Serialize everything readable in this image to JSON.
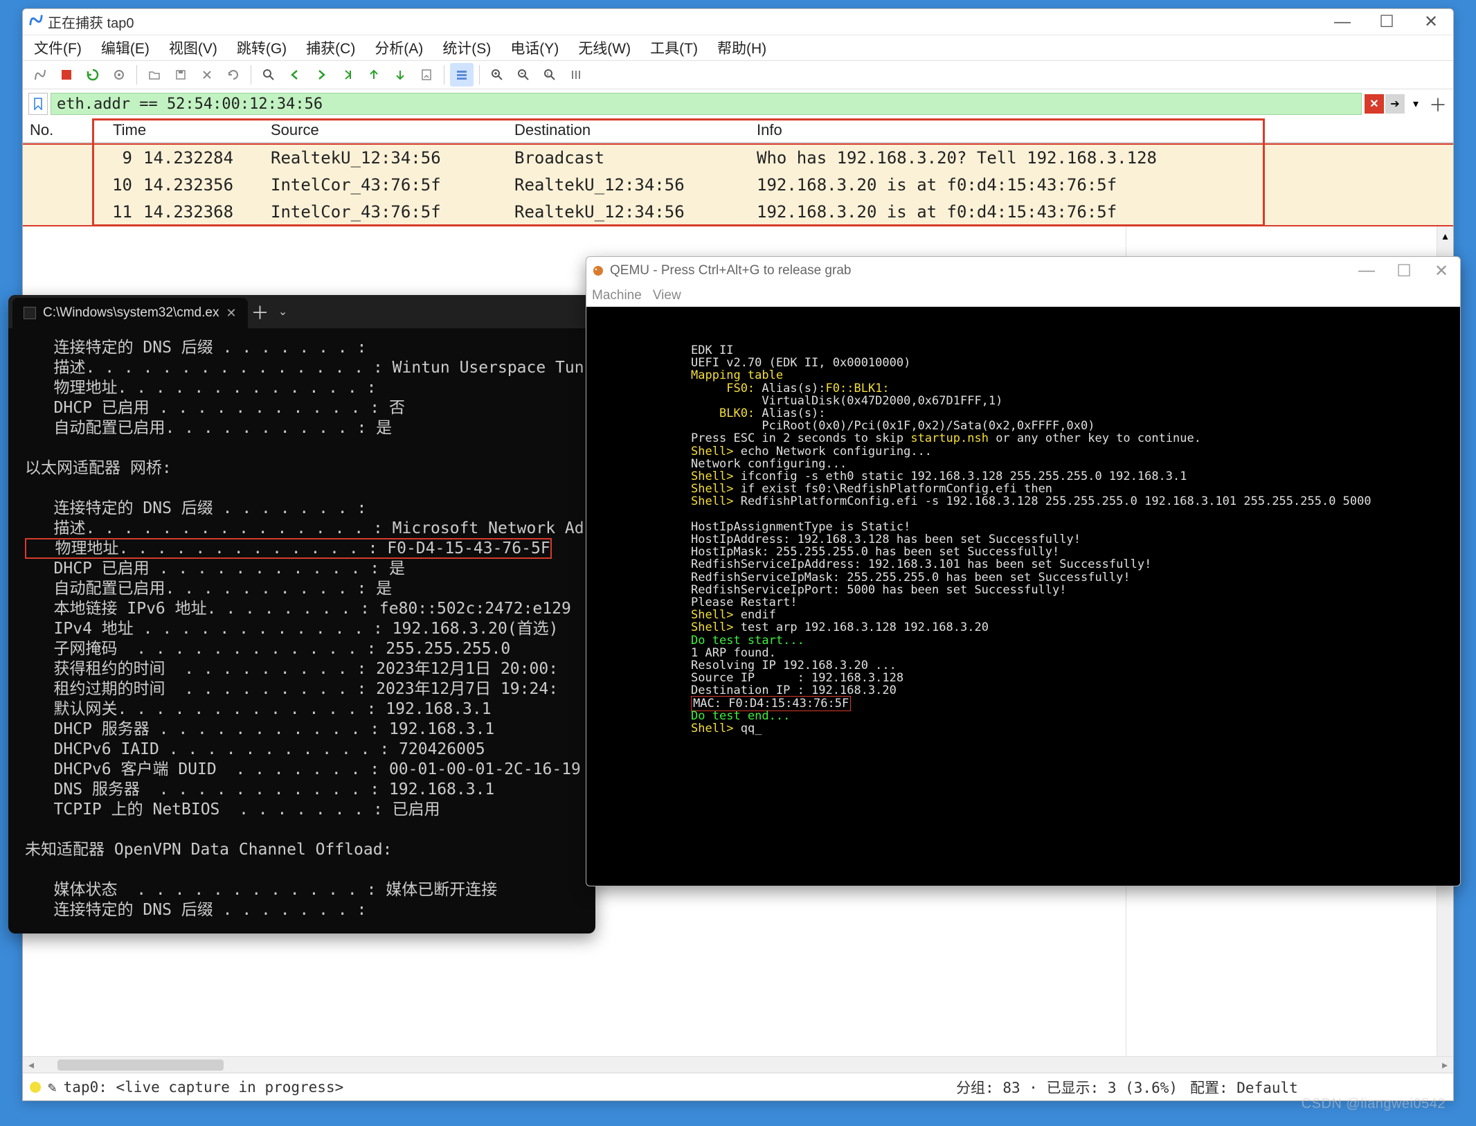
{
  "wireshark": {
    "title": "正在捕获 tap0",
    "window_buttons": {
      "min": "—",
      "max": "☐",
      "close": "✕"
    },
    "menus": [
      "文件(F)",
      "编辑(E)",
      "视图(V)",
      "跳转(G)",
      "捕获(C)",
      "分析(A)",
      "统计(S)",
      "电话(Y)",
      "无线(W)",
      "工具(T)",
      "帮助(H)"
    ],
    "filter_value": "eth.addr == 52:54:00:12:34:56",
    "columns": {
      "no": "No.",
      "time": "Time",
      "src": "Source",
      "dst": "Destination",
      "info": "Info"
    },
    "packets": [
      {
        "no": "9",
        "time": "14.232284",
        "src": "RealtekU_12:34:56",
        "dst": "Broadcast",
        "info": "Who has 192.168.3.20? Tell 192.168.3.128"
      },
      {
        "no": "10",
        "time": "14.232356",
        "src": "IntelCor_43:76:5f",
        "dst": "RealtekU_12:34:56",
        "info": "192.168.3.20 is at f0:d4:15:43:76:5f"
      },
      {
        "no": "11",
        "time": "14.232368",
        "src": "IntelCor_43:76:5f",
        "dst": "RealtekU_12:34:56",
        "info": "192.168.3.20 is at f0:d4:15:43:76:5f"
      }
    ],
    "status": {
      "left": "tap0: <live capture in progress>",
      "mid": "分组: 83 · 已显示: 3 (3.6%)",
      "right": "配置: Default"
    }
  },
  "cmd": {
    "tab_title": "C:\\Windows\\system32\\cmd.ex",
    "body_lines": [
      "   连接特定的 DNS 后缀 . . . . . . . :",
      "   描述. . . . . . . . . . . . . . . : Wintun Userspace Tun",
      "   物理地址. . . . . . . . . . . . . :",
      "   DHCP 已启用 . . . . . . . . . . . : 否",
      "   自动配置已启用. . . . . . . . . . : 是",
      "",
      "以太网适配器 网桥:",
      "",
      "   连接特定的 DNS 后缀 . . . . . . . :",
      "   描述. . . . . . . . . . . . . . . : Microsoft Network Ad",
      "   物理地址. . . . . . . . . . . . . : F0-D4-15-43-76-5F",
      "   DHCP 已启用 . . . . . . . . . . . : 是",
      "   自动配置已启用. . . . . . . . . . : 是",
      "   本地链接 IPv6 地址. . . . . . . . : fe80::502c:2472:e129",
      "   IPv4 地址 . . . . . . . . . . . . : 192.168.3.20(首选)",
      "   子网掩码  . . . . . . . . . . . . : 255.255.255.0",
      "   获得租约的时间  . . . . . . . . . : 2023年12月1日 20:00:",
      "   租约过期的时间  . . . . . . . . . : 2023年12月7日 19:24:",
      "   默认网关. . . . . . . . . . . . . : 192.168.3.1",
      "   DHCP 服务器 . . . . . . . . . . . : 192.168.3.1",
      "   DHCPv6 IAID . . . . . . . . . . . : 720426005",
      "   DHCPv6 客户端 DUID  . . . . . . . : 00-01-00-01-2C-16-19",
      "   DNS 服务器  . . . . . . . . . . . : 192.168.3.1",
      "   TCPIP 上的 NetBIOS  . . . . . . . : 已启用",
      "",
      "未知适配器 OpenVPN Data Channel Offload:",
      "",
      "   媒体状态  . . . . . . . . . . . . : 媒体已断开连接",
      "   连接特定的 DNS 后缀 . . . . . . . :"
    ],
    "hl_index": 10
  },
  "qemu": {
    "title": "QEMU - Press Ctrl+Alt+G to release grab",
    "menus": [
      "Machine",
      "View"
    ],
    "window_buttons": {
      "min": "—",
      "max": "☐",
      "close": "✕"
    },
    "segments": [
      {
        "cls": "w",
        "t": "             EDK II\n"
      },
      {
        "cls": "w",
        "t": "             UEFI v2.70 (EDK II, 0x00010000)\n"
      },
      {
        "cls": "y",
        "t": "             Mapping table\n"
      },
      {
        "cls": "y",
        "t": "                  FS0: "
      },
      {
        "cls": "w",
        "t": "Alias(s):"
      },
      {
        "cls": "y",
        "t": "F0::BLK1:\n"
      },
      {
        "cls": "w",
        "t": "                       VirtualDisk(0x47D2000,0x67D1FFF,1)\n"
      },
      {
        "cls": "y",
        "t": "                 BLK0: "
      },
      {
        "cls": "w",
        "t": "Alias(s):\n"
      },
      {
        "cls": "w",
        "t": "                       PciRoot(0x0)/Pci(0x1F,0x2)/Sata(0x2,0xFFFF,0x0)\n"
      },
      {
        "cls": "w",
        "t": "             Press "
      },
      {
        "cls": "w",
        "t": "ESC"
      },
      {
        "cls": "w",
        "t": " in 2 seconds to skip "
      },
      {
        "cls": "y",
        "t": "startup.nsh"
      },
      {
        "cls": "w",
        "t": " or any other key to continue.\n"
      },
      {
        "cls": "y",
        "t": "             Shell> "
      },
      {
        "cls": "w",
        "t": "echo Network configuring...\n"
      },
      {
        "cls": "w",
        "t": "             Network configuring...\n"
      },
      {
        "cls": "y",
        "t": "             Shell> "
      },
      {
        "cls": "w",
        "t": "ifconfig -s eth0 static 192.168.3.128 255.255.255.0 192.168.3.1\n"
      },
      {
        "cls": "y",
        "t": "             Shell> "
      },
      {
        "cls": "w",
        "t": "if exist fs0:\\RedfishPlatformConfig.efi then\n"
      },
      {
        "cls": "y",
        "t": "             Shell> "
      },
      {
        "cls": "w",
        "t": "RedfishPlatformConfig.efi -s 192.168.3.128 255.255.255.0 192.168.3.101 255.255.255.0 5000\n"
      },
      {
        "cls": "w",
        "t": "\n"
      },
      {
        "cls": "w",
        "t": "             HostIpAssignmentType is Static!\n"
      },
      {
        "cls": "w",
        "t": "             HostIpAddress: 192.168.3.128 has been set Successfully!\n"
      },
      {
        "cls": "w",
        "t": "             HostIpMask: 255.255.255.0 has been set Successfully!\n"
      },
      {
        "cls": "w",
        "t": "             RedfishServiceIpAddress: 192.168.3.101 has been set Successfully!\n"
      },
      {
        "cls": "w",
        "t": "             RedfishServiceIpMask: 255.255.255.0 has been set Successfully!\n"
      },
      {
        "cls": "w",
        "t": "             RedfishServiceIpPort: 5000 has been set Successfully!\n"
      },
      {
        "cls": "w",
        "t": "             Please Restart!\n"
      },
      {
        "cls": "y",
        "t": "             Shell> "
      },
      {
        "cls": "w",
        "t": "endif\n"
      },
      {
        "cls": "y",
        "t": "             Shell> "
      },
      {
        "cls": "w",
        "t": "test arp 192.168.3.128 192.168.3.20\n"
      },
      {
        "cls": "g",
        "t": "             Do test start...\n"
      },
      {
        "cls": "w",
        "t": "             1 ARP found.\n"
      },
      {
        "cls": "w",
        "t": "             Resolving IP 192.168.3.20 ...\n"
      },
      {
        "cls": "w",
        "t": "             Source IP      : 192.168.3.128\n"
      },
      {
        "cls": "w",
        "t": "             Destination IP : 192.168.3.20\n"
      },
      {
        "cls": "w",
        "t": "             "
      },
      {
        "cls": "w hlq",
        "t": "MAC: F0:D4:15:43:76:5F"
      },
      {
        "cls": "w",
        "t": "\n"
      },
      {
        "cls": "g",
        "t": "             Do test end...\n"
      },
      {
        "cls": "y",
        "t": "             Shell> "
      },
      {
        "cls": "w",
        "t": "qq_"
      }
    ]
  },
  "watermark": "CSDN @liangwei0542"
}
